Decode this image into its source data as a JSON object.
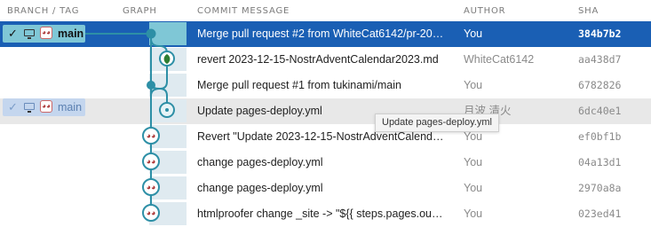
{
  "header": {
    "branch_tag": "BRANCH / TAG",
    "graph": "GRAPH",
    "commit_message": "COMMIT MESSAGE",
    "author": "AUTHOR",
    "sha": "SHA"
  },
  "branches": [
    {
      "name": "main",
      "check": "✓",
      "row": 0,
      "style": "active"
    },
    {
      "name": "main",
      "check": "✓",
      "row": 3,
      "style": "remote"
    }
  ],
  "commits": [
    {
      "message": "Merge pull request #2 from WhiteCat6142/pr-20…",
      "author": "You",
      "sha": "384b7b2"
    },
    {
      "message": "revert 2023-12-15-NostrAdventCalendar2023.md",
      "author": "WhiteCat6142",
      "sha": "aa438d7"
    },
    {
      "message": "Merge pull request #1 from tukinami/main",
      "author": "You",
      "sha": "6782826"
    },
    {
      "message": "Update pages-deploy.yml",
      "author": "月波 清火",
      "sha": "6dc40e1"
    },
    {
      "message": "Revert \"Update 2023-12-15-NostrAdventCalend…",
      "author": "You",
      "sha": "ef0bf1b"
    },
    {
      "message": "change pages-deploy.yml",
      "author": "You",
      "sha": "04a13d1"
    },
    {
      "message": "change pages-deploy.yml",
      "author": "You",
      "sha": "2970a8a"
    },
    {
      "message": "htmlproofer change _site -> \"${{ steps.pages.ou…",
      "author": "You",
      "sha": "023ed41"
    }
  ],
  "tooltip": "Update pages-deploy.yml",
  "colors": {
    "selected": "#1a5fb4",
    "graph_line": "#2d8fa6",
    "branch_active": "#7fc7d6",
    "branch_remote": "#c4d6ee",
    "merge_node": "#2e7d32"
  },
  "icons": [
    "check-icon",
    "monitor-icon",
    "avatar-icon",
    "merge-node-icon"
  ]
}
